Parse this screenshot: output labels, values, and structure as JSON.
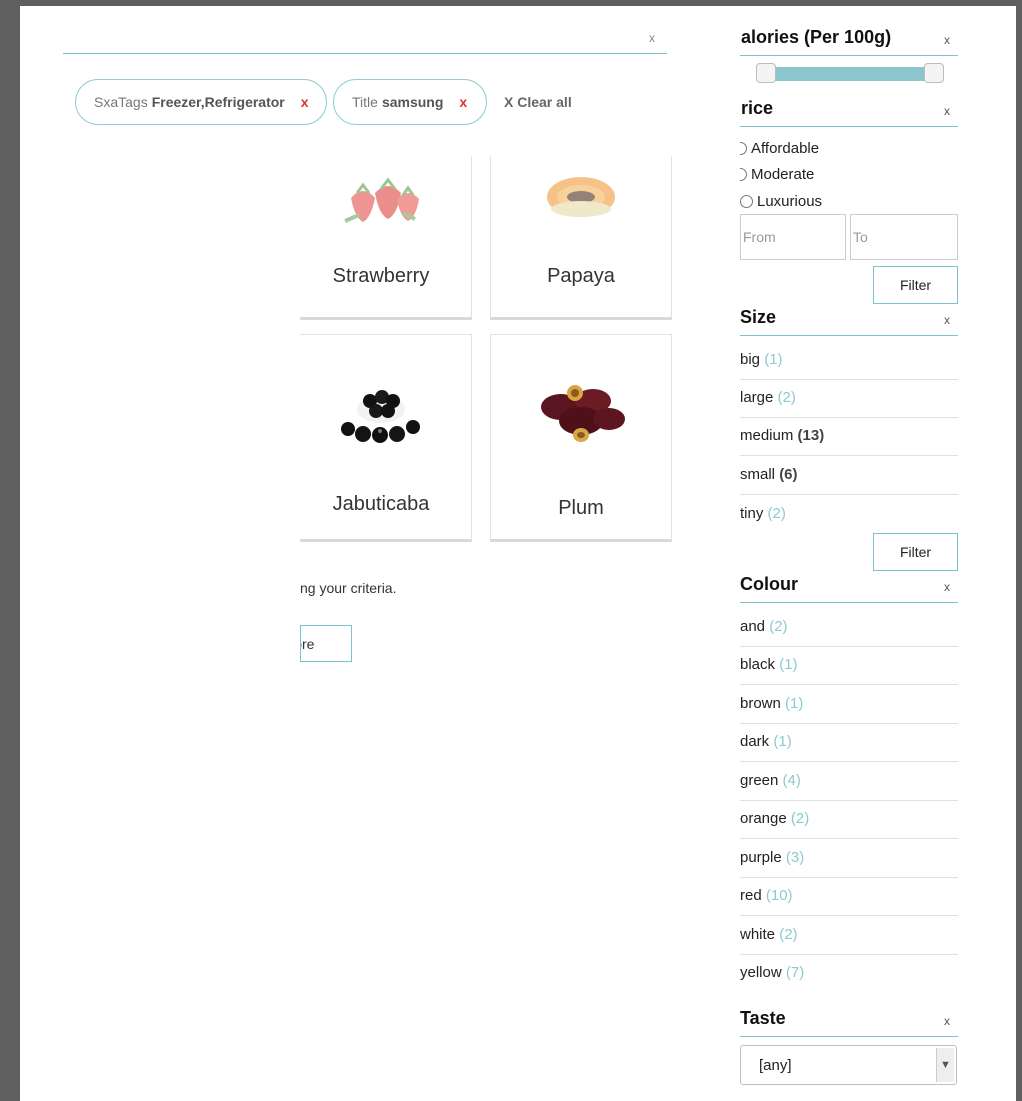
{
  "search": {
    "clear_label": "x"
  },
  "active_facets": [
    {
      "label": "SxaTags",
      "value": "Freezer,Refrigerator",
      "remove": "x"
    },
    {
      "label": "Title",
      "value": "samsung",
      "remove": "x"
    }
  ],
  "clear_all_label": "X Clear all",
  "products": [
    {
      "title": "Strawberry"
    },
    {
      "title": "Papaya"
    },
    {
      "title": "Jabuticaba"
    },
    {
      "title": "Plum"
    }
  ],
  "results_message": "ng your criteria.",
  "load_button_label": "Load More",
  "sidebar": {
    "calories": {
      "title": "alories (Per 100g)",
      "close": "x",
      "range": [
        0,
        1
      ]
    },
    "price": {
      "title": "rice",
      "close": "x",
      "options": [
        "Affordable",
        "Moderate",
        "Luxurious"
      ],
      "from_placeholder": "From",
      "to_placeholder": "To",
      "filter_label": "Filter"
    },
    "size": {
      "title": "Size",
      "close": "x",
      "items": [
        {
          "label": "big",
          "count": "(1)"
        },
        {
          "label": "large",
          "count": "(2)"
        },
        {
          "label": "medium",
          "count": "(13)"
        },
        {
          "label": "small",
          "count": "(6)"
        },
        {
          "label": "tiny",
          "count": "(2)"
        }
      ],
      "filter_label": "Filter"
    },
    "colour": {
      "title": "Colour",
      "close": "x",
      "items": [
        {
          "label": "and",
          "count": "(2)"
        },
        {
          "label": "black",
          "count": "(1)"
        },
        {
          "label": "brown",
          "count": "(1)"
        },
        {
          "label": "dark",
          "count": "(1)"
        },
        {
          "label": "green",
          "count": "(4)"
        },
        {
          "label": "orange",
          "count": "(2)"
        },
        {
          "label": "purple",
          "count": "(3)"
        },
        {
          "label": "red",
          "count": "(10)"
        },
        {
          "label": "white",
          "count": "(2)"
        },
        {
          "label": "yellow",
          "count": "(7)"
        }
      ]
    },
    "taste": {
      "title": "Taste",
      "close": "x",
      "selected": "[any]"
    }
  },
  "colors": {
    "accent": "#7cc4cc",
    "remove_x": "#d9343c",
    "count": "#8ccad0"
  }
}
